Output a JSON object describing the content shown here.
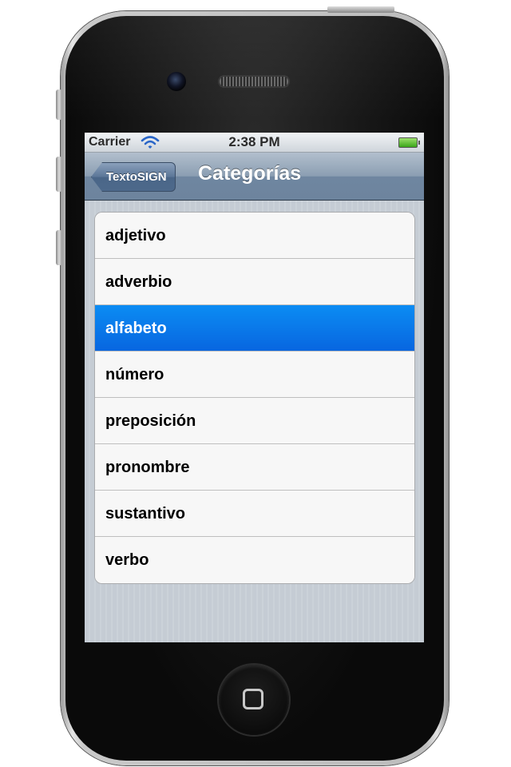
{
  "status_bar": {
    "carrier": "Carrier",
    "time": "2:38 PM"
  },
  "nav_bar": {
    "back_label": "TextoSIGN",
    "title": "Categorías"
  },
  "categories": [
    {
      "label": "adjetivo",
      "selected": false
    },
    {
      "label": "adverbio",
      "selected": false
    },
    {
      "label": "alfabeto",
      "selected": true
    },
    {
      "label": "número",
      "selected": false
    },
    {
      "label": "preposición",
      "selected": false
    },
    {
      "label": "pronombre",
      "selected": false
    },
    {
      "label": "sustantivo",
      "selected": false
    },
    {
      "label": "verbo",
      "selected": false
    }
  ],
  "colors": {
    "selected_row": "#0a78ea",
    "nav_bar": "#8b9eb2"
  }
}
